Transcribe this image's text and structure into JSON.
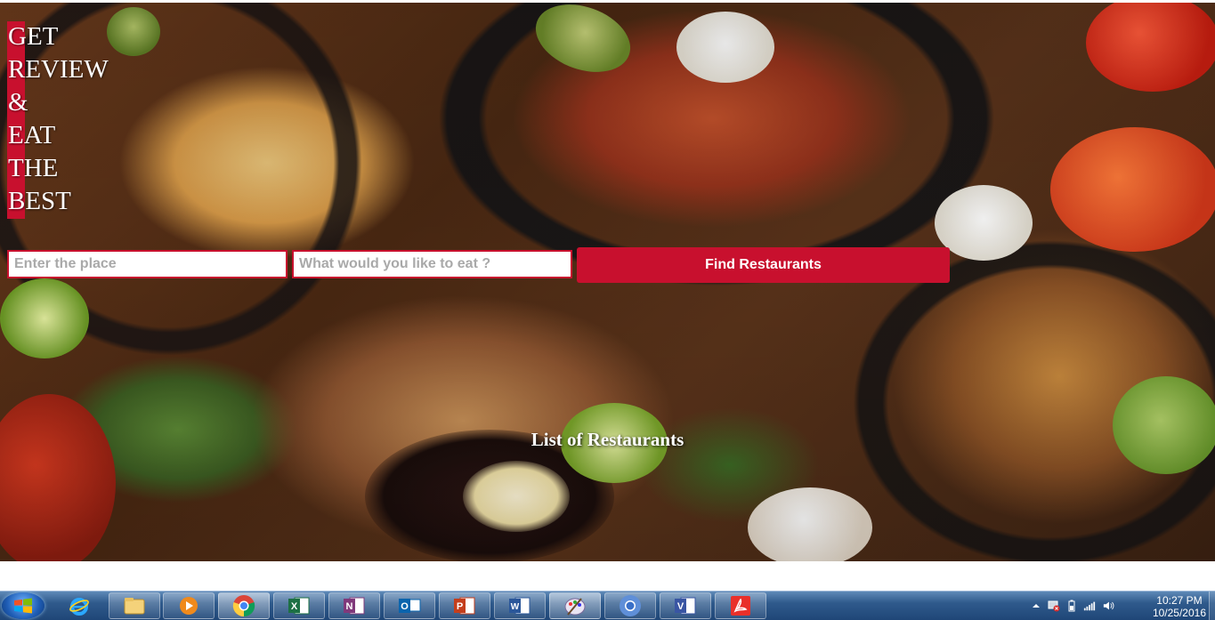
{
  "brand": {
    "tagline_lines": [
      "GET",
      "REVIEW",
      "&",
      "EAT",
      "THE",
      "BEST"
    ]
  },
  "search": {
    "place_placeholder": "Enter the place",
    "food_placeholder": "What would you like to eat ?",
    "button_label": "Find Restaurants"
  },
  "main": {
    "list_heading": "List of Restaurants"
  },
  "colors": {
    "accent": "#c8102e",
    "taskbar": "#2f5a8c"
  },
  "taskbar": {
    "apps": [
      {
        "name": "internet-explorer",
        "icon": "ie-icon"
      },
      {
        "name": "file-explorer",
        "icon": "folder-icon"
      },
      {
        "name": "media-player",
        "icon": "media-player-icon"
      },
      {
        "name": "chrome",
        "icon": "chrome-icon"
      },
      {
        "name": "excel",
        "icon": "excel-icon",
        "letter": "X"
      },
      {
        "name": "onenote",
        "icon": "onenote-icon",
        "letter": "N"
      },
      {
        "name": "outlook",
        "icon": "outlook-icon",
        "letter": "O"
      },
      {
        "name": "powerpoint",
        "icon": "powerpoint-icon",
        "letter": "P"
      },
      {
        "name": "word",
        "icon": "word-icon",
        "letter": "W"
      },
      {
        "name": "paint",
        "icon": "paint-icon"
      },
      {
        "name": "chrome-second",
        "icon": "chrome-icon"
      },
      {
        "name": "visio",
        "icon": "visio-icon",
        "letter": "V"
      },
      {
        "name": "acrobat",
        "icon": "acrobat-icon"
      }
    ],
    "clock_time": "10:27 PM",
    "clock_date": "10/25/2016"
  }
}
